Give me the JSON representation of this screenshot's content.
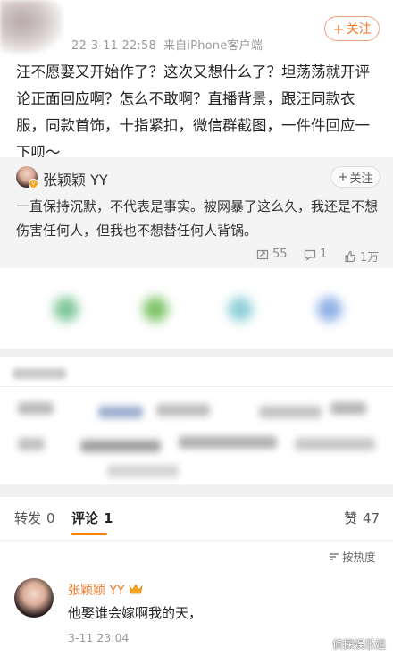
{
  "post": {
    "time": "22-3-11 22:58",
    "source": "来自iPhone客户端",
    "follow_label": "关注",
    "text": "汪不愿娶又开始作了？这次又想什么了？坦荡荡就开评论正面回应啊？怎么不敢啊？直播背景，跟汪同款衣服，同款首饰，十指紧扣，微信群截图，一件件回应一下呗～"
  },
  "quoted": {
    "user_name": "张颖颖 YY",
    "follow_label": "关注",
    "text": "一直保持沉默，不代表是事实。被网暴了这么久，我还是不想伤害任何人，但我也不想替任何人背锅。",
    "reposts": "55",
    "comments": "1",
    "likes": "1万"
  },
  "tabs": {
    "repost_label": "转发",
    "repost_count": "0",
    "comment_label": "评论",
    "comment_count": "1",
    "like_label": "赞",
    "like_count": "47",
    "sort_label": "按热度"
  },
  "comment": {
    "user_name": "张颖颖 YY",
    "text": "他娶谁会嫁啊我的天，",
    "time": "3-11 23:04"
  },
  "watermark": "侦探娱乐姐",
  "colors": {
    "accent": "#ff8200",
    "link": "#e9772a",
    "muted": "#9a9a9a",
    "card_bg": "#f4f4f4"
  }
}
